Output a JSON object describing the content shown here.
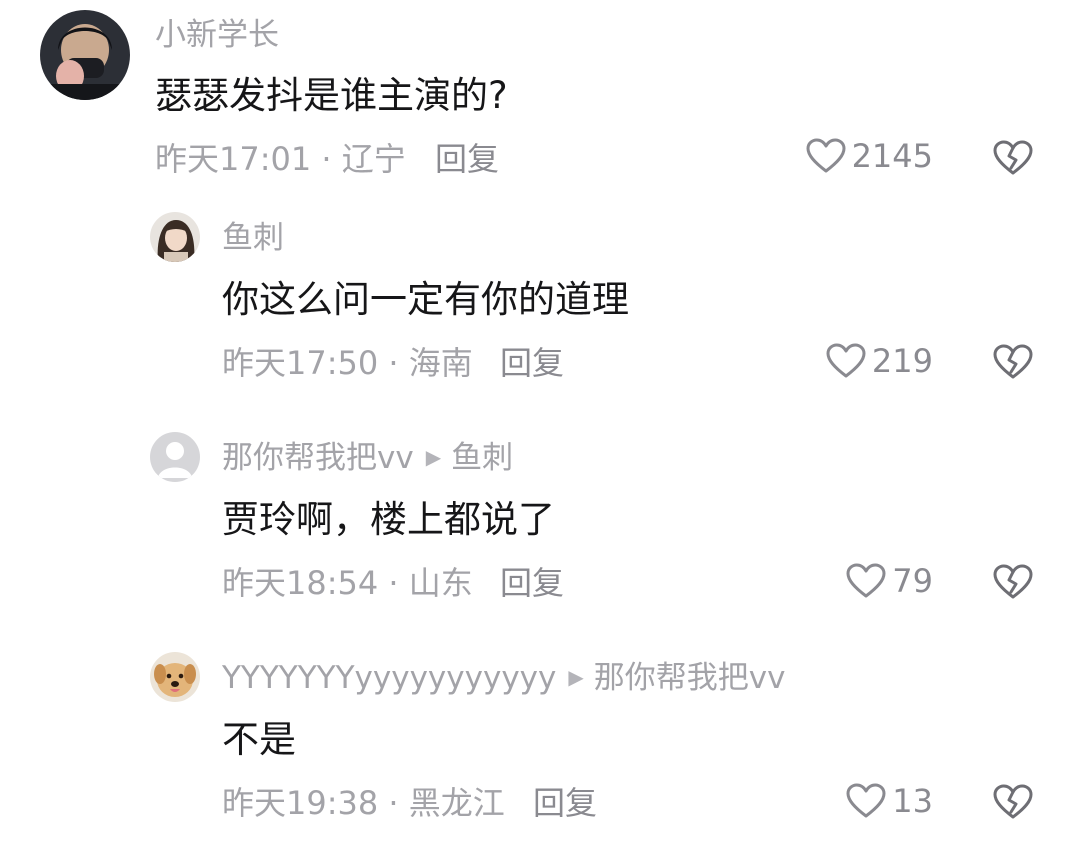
{
  "comments": [
    {
      "username": "小新学长",
      "text": "瑟瑟发抖是谁主演的?",
      "time": "昨天17:01",
      "location": "辽宁",
      "reply_label": "回复",
      "likes": "2145",
      "icons": {
        "like": "heart-outline-icon",
        "dislike": "broken-heart-icon"
      }
    },
    {
      "username": "鱼刺",
      "text": "你这么问一定有你的道理",
      "time": "昨天17:50",
      "location": "海南",
      "reply_label": "回复",
      "likes": "219"
    },
    {
      "username": "那你帮我把vv",
      "reply_to": "鱼刺",
      "text": "贾玲啊，楼上都说了",
      "time": "昨天18:54",
      "location": "山东",
      "reply_label": "回复",
      "likes": "79"
    },
    {
      "username": "YYYYYYYyyyyyyyyyyy",
      "reply_to": "那你帮我把vv",
      "text": "不是",
      "time": "昨天19:38",
      "location": "黑龙江",
      "reply_label": "回复",
      "likes": "13"
    }
  ],
  "separator": "·",
  "colors": {
    "text_primary": "#161618",
    "text_secondary": "#a3a3a8",
    "icon": "#8a8a90"
  }
}
